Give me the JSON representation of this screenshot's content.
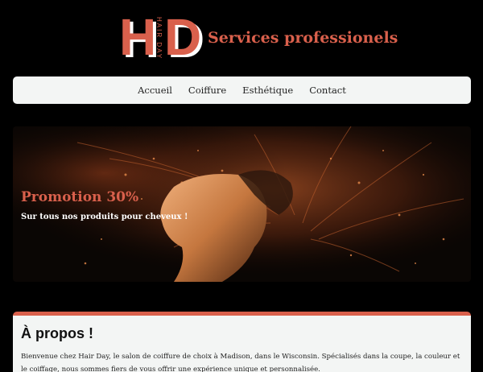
{
  "brand": {
    "logo_h": "H",
    "logo_d": "D",
    "logo_vertical": "HAIR DAY",
    "title": "Services professionels",
    "accent_color": "#d9604c"
  },
  "nav": {
    "items": [
      {
        "label": "Accueil"
      },
      {
        "label": "Coiffure"
      },
      {
        "label": "Esthétique"
      },
      {
        "label": "Contact"
      }
    ]
  },
  "hero": {
    "promo_title": "Promotion 30%",
    "promo_subtitle": "Sur tous nos produits pour cheveux !",
    "image": "woman-hair-particles-photo"
  },
  "about": {
    "heading": "À propos !",
    "text": "Bienvenue chez Hair Day, le salon de coiffure de choix à Madison, dans le Wisconsin. Spécialisés dans la coupe, la couleur et le coiffage, nous sommes fiers de vous offrir une expérience unique et personnalisée."
  }
}
